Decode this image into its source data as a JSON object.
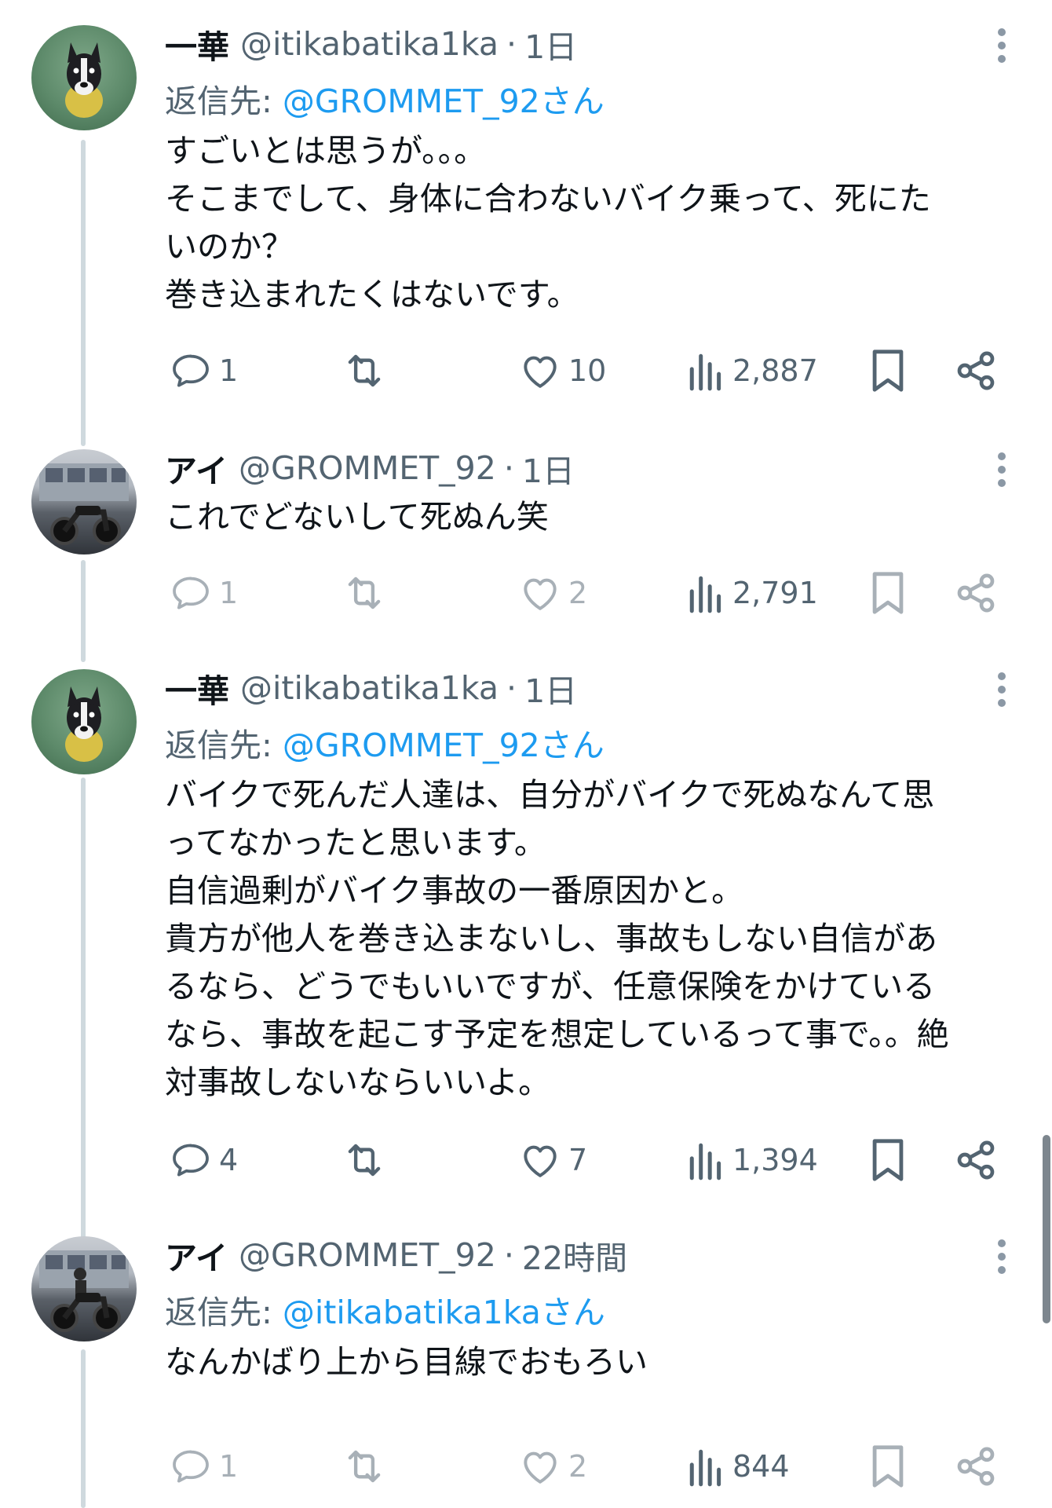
{
  "tweets": [
    {
      "name": "一華",
      "handle": "@itikabatika1ka",
      "dot": "·",
      "time": "1日",
      "reply_prefix": "返信先: ",
      "reply_mention": "@GROMMET_92さん",
      "lines": [
        "すごいとは思うが。。。",
        "そこまでして、身体に合わないバイク乗って、死にた",
        "いのか？",
        "巻き込まれたくはないです。"
      ],
      "stats": {
        "replies": "1",
        "likes": "10",
        "views": "2,887"
      }
    },
    {
      "name": "アイ",
      "handle": "@GROMMET_92",
      "dot": "·",
      "time": "1日",
      "lines": [
        "これでどないして死ぬん笑"
      ],
      "stats": {
        "replies": "1",
        "likes": "2",
        "views": "2,791"
      }
    },
    {
      "name": "一華",
      "handle": "@itikabatika1ka",
      "dot": "·",
      "time": "1日",
      "reply_prefix": "返信先: ",
      "reply_mention": "@GROMMET_92さん",
      "lines": [
        "バイクで死んだ人達は、自分がバイクで死ぬなんて思",
        "ってなかったと思います。",
        "自信過剰がバイク事故の一番原因かと。",
        "貴方が他人を巻き込まないし、事故もしない自信があ",
        "るなら、どうでもいいですが、任意保険をかけている",
        "なら、事故を起こす予定を想定しているって事で。。絶",
        "対事故しないならいいよ。"
      ],
      "stats": {
        "replies": "4",
        "likes": "7",
        "views": "1,394"
      }
    },
    {
      "name": "アイ",
      "handle": "@GROMMET_92",
      "dot": "·",
      "time": "22時間",
      "reply_prefix": "返信先: ",
      "reply_mention": "@itikabatika1kaさん",
      "lines": [
        "なんかばり上から目線でおもろい"
      ],
      "stats": {
        "replies": "1",
        "likes": "2",
        "views": "844"
      }
    }
  ],
  "colors": {
    "text": "#0f1419",
    "secondary": "#536471",
    "link": "#1d9bf0",
    "thread_line": "#cfd9de"
  }
}
